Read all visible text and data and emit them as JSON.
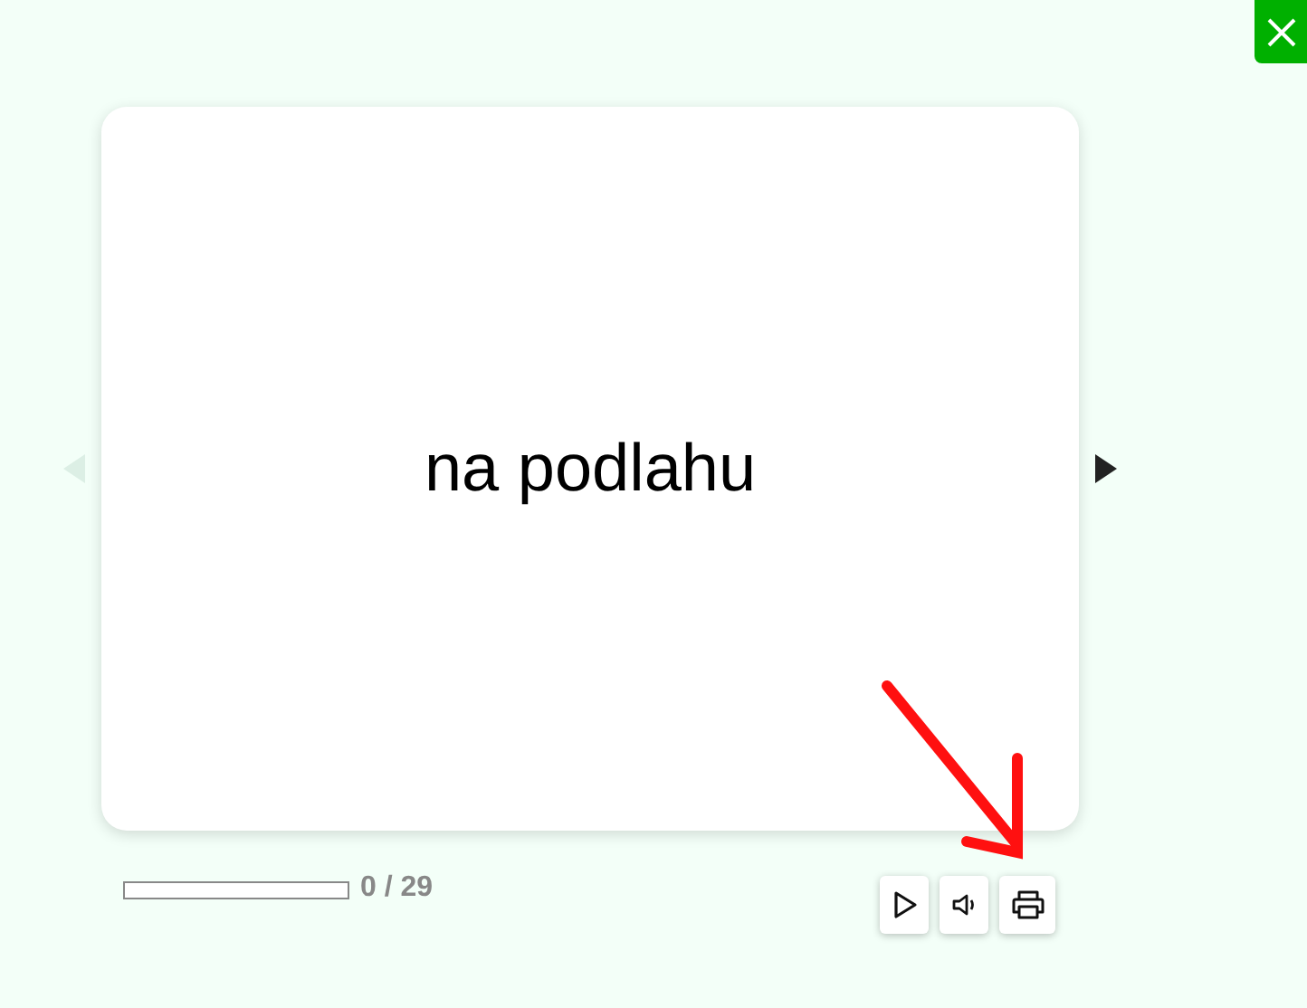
{
  "card": {
    "text": "na podlahu"
  },
  "navigation": {
    "previous_disabled": true,
    "next_disabled": false
  },
  "progress": {
    "level": 0,
    "reading": "0 / 29"
  },
  "annotation": {
    "kind": "arrow"
  }
}
